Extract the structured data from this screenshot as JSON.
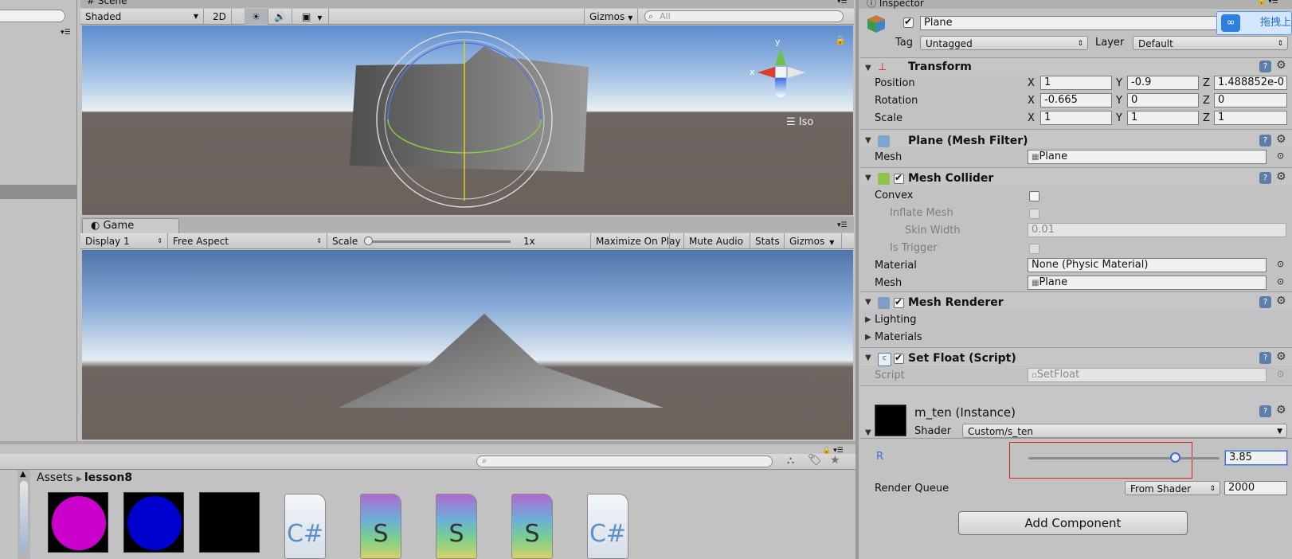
{
  "scene": {
    "tab": "Scene",
    "shading": "Shaded",
    "mode_2d": "2D",
    "gizmos": "Gizmos",
    "search_placeholder": "All",
    "iso": "Iso",
    "axis_y": "y",
    "axis_x": "x"
  },
  "game": {
    "tab": "Game",
    "display": "Display 1",
    "aspect": "Free Aspect",
    "scale_label": "Scale",
    "scale_value": "1x",
    "maximize": "Maximize On Play",
    "mute": "Mute Audio",
    "stats": "Stats",
    "gizmos": "Gizmos"
  },
  "project": {
    "breadcrumb_root": "Assets",
    "breadcrumb_folder": "lesson8",
    "assets": [
      {
        "type": "material",
        "color": "#cc00cc"
      },
      {
        "type": "material",
        "color": "#0000cc"
      },
      {
        "type": "material",
        "color": "#000000"
      },
      {
        "type": "script",
        "glyph": "C#"
      },
      {
        "type": "shader",
        "glyph": "S"
      },
      {
        "type": "shader",
        "glyph": "S"
      },
      {
        "type": "shader",
        "glyph": "S"
      },
      {
        "type": "script",
        "glyph": "C#"
      }
    ]
  },
  "inspector": {
    "tab": "Inspector",
    "object_name": "Plane",
    "tag_label": "Tag",
    "tag_value": "Untagged",
    "layer_label": "Layer",
    "layer_value": "Default",
    "overlay_btn": "拖拽上",
    "transform": {
      "title": "Transform",
      "position_label": "Position",
      "rotation_label": "Rotation",
      "scale_label": "Scale",
      "axis_x": "X",
      "axis_y": "Y",
      "axis_z": "Z",
      "position": {
        "x": "1",
        "y": "-0.9",
        "z": "1.488852e-0"
      },
      "rotation": {
        "x": "-0.665",
        "y": "0",
        "z": "0"
      },
      "scale": {
        "x": "1",
        "y": "1",
        "z": "1"
      }
    },
    "mesh_filter": {
      "title": "Plane (Mesh Filter)",
      "mesh_label": "Mesh",
      "mesh_value": "Plane"
    },
    "mesh_collider": {
      "title": "Mesh Collider",
      "convex_label": "Convex",
      "inflate_label": "Inflate Mesh",
      "skin_label": "Skin Width",
      "skin_value": "0.01",
      "trigger_label": "Is Trigger",
      "material_label": "Material",
      "material_value": "None (Physic Material)",
      "mesh_label": "Mesh",
      "mesh_value": "Plane"
    },
    "mesh_renderer": {
      "title": "Mesh Renderer",
      "lighting": "Lighting",
      "materials": "Materials"
    },
    "set_float": {
      "title": "Set Float (Script)",
      "script_label": "Script",
      "script_value": "SetFloat"
    },
    "material": {
      "name": "m_ten (Instance)",
      "shader_label": "Shader",
      "shader_value": "Custom/s_ten",
      "r_label": "R",
      "r_value": "3.85",
      "r_fraction": 0.765,
      "render_queue_label": "Render Queue",
      "render_queue_mode": "From Shader",
      "render_queue_value": "2000"
    },
    "add_component": "Add Component"
  },
  "colors": {
    "accent_blue": "#3d6fd0",
    "highlight_red": "#e02020"
  }
}
